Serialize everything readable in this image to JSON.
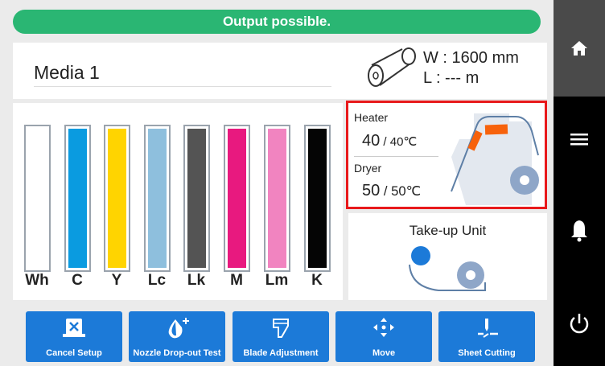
{
  "status": {
    "text": "Output possible.",
    "color": "#2ab673"
  },
  "media": {
    "name": "Media 1",
    "width_label": "W : 1600 mm",
    "length_label": "L : --- m",
    "icon": "media-roll-icon"
  },
  "inks": [
    {
      "label": "Wh",
      "color": "#ffffff"
    },
    {
      "label": "C",
      "color": "#0a9be0"
    },
    {
      "label": "Y",
      "color": "#ffd400"
    },
    {
      "label": "Lc",
      "color": "#8ebfdd"
    },
    {
      "label": "Lk",
      "color": "#545454"
    },
    {
      "label": "M",
      "color": "#e8197f"
    },
    {
      "label": "Lm",
      "color": "#f184c0"
    },
    {
      "label": "K",
      "color": "#050505"
    }
  ],
  "heater": {
    "heater_label": "Heater",
    "heater_current": "40",
    "heater_target": " / 40℃",
    "dryer_label": "Dryer",
    "dryer_current": "50",
    "dryer_target": " / 50℃",
    "highlight_color": "#e8191b"
  },
  "takeup": {
    "title": "Take-up Unit"
  },
  "buttons": [
    {
      "label": "Cancel Setup",
      "icon": "cancel-setup-icon"
    },
    {
      "label": "Nozzle Drop-out Test",
      "icon": "nozzle-icon"
    },
    {
      "label": "Blade Adjustment",
      "icon": "blade-icon"
    },
    {
      "label": "Move",
      "icon": "move-arrows-icon"
    },
    {
      "label": "Sheet Cutting",
      "icon": "sheet-cut-icon"
    }
  ],
  "sidebar": [
    "home-icon",
    "menu-icon",
    "bell-icon",
    "power-icon"
  ],
  "colors": {
    "accent_blue": "#1c7ad8",
    "sidebar_bg": "#000000",
    "home_bg": "#4a4a4a"
  }
}
